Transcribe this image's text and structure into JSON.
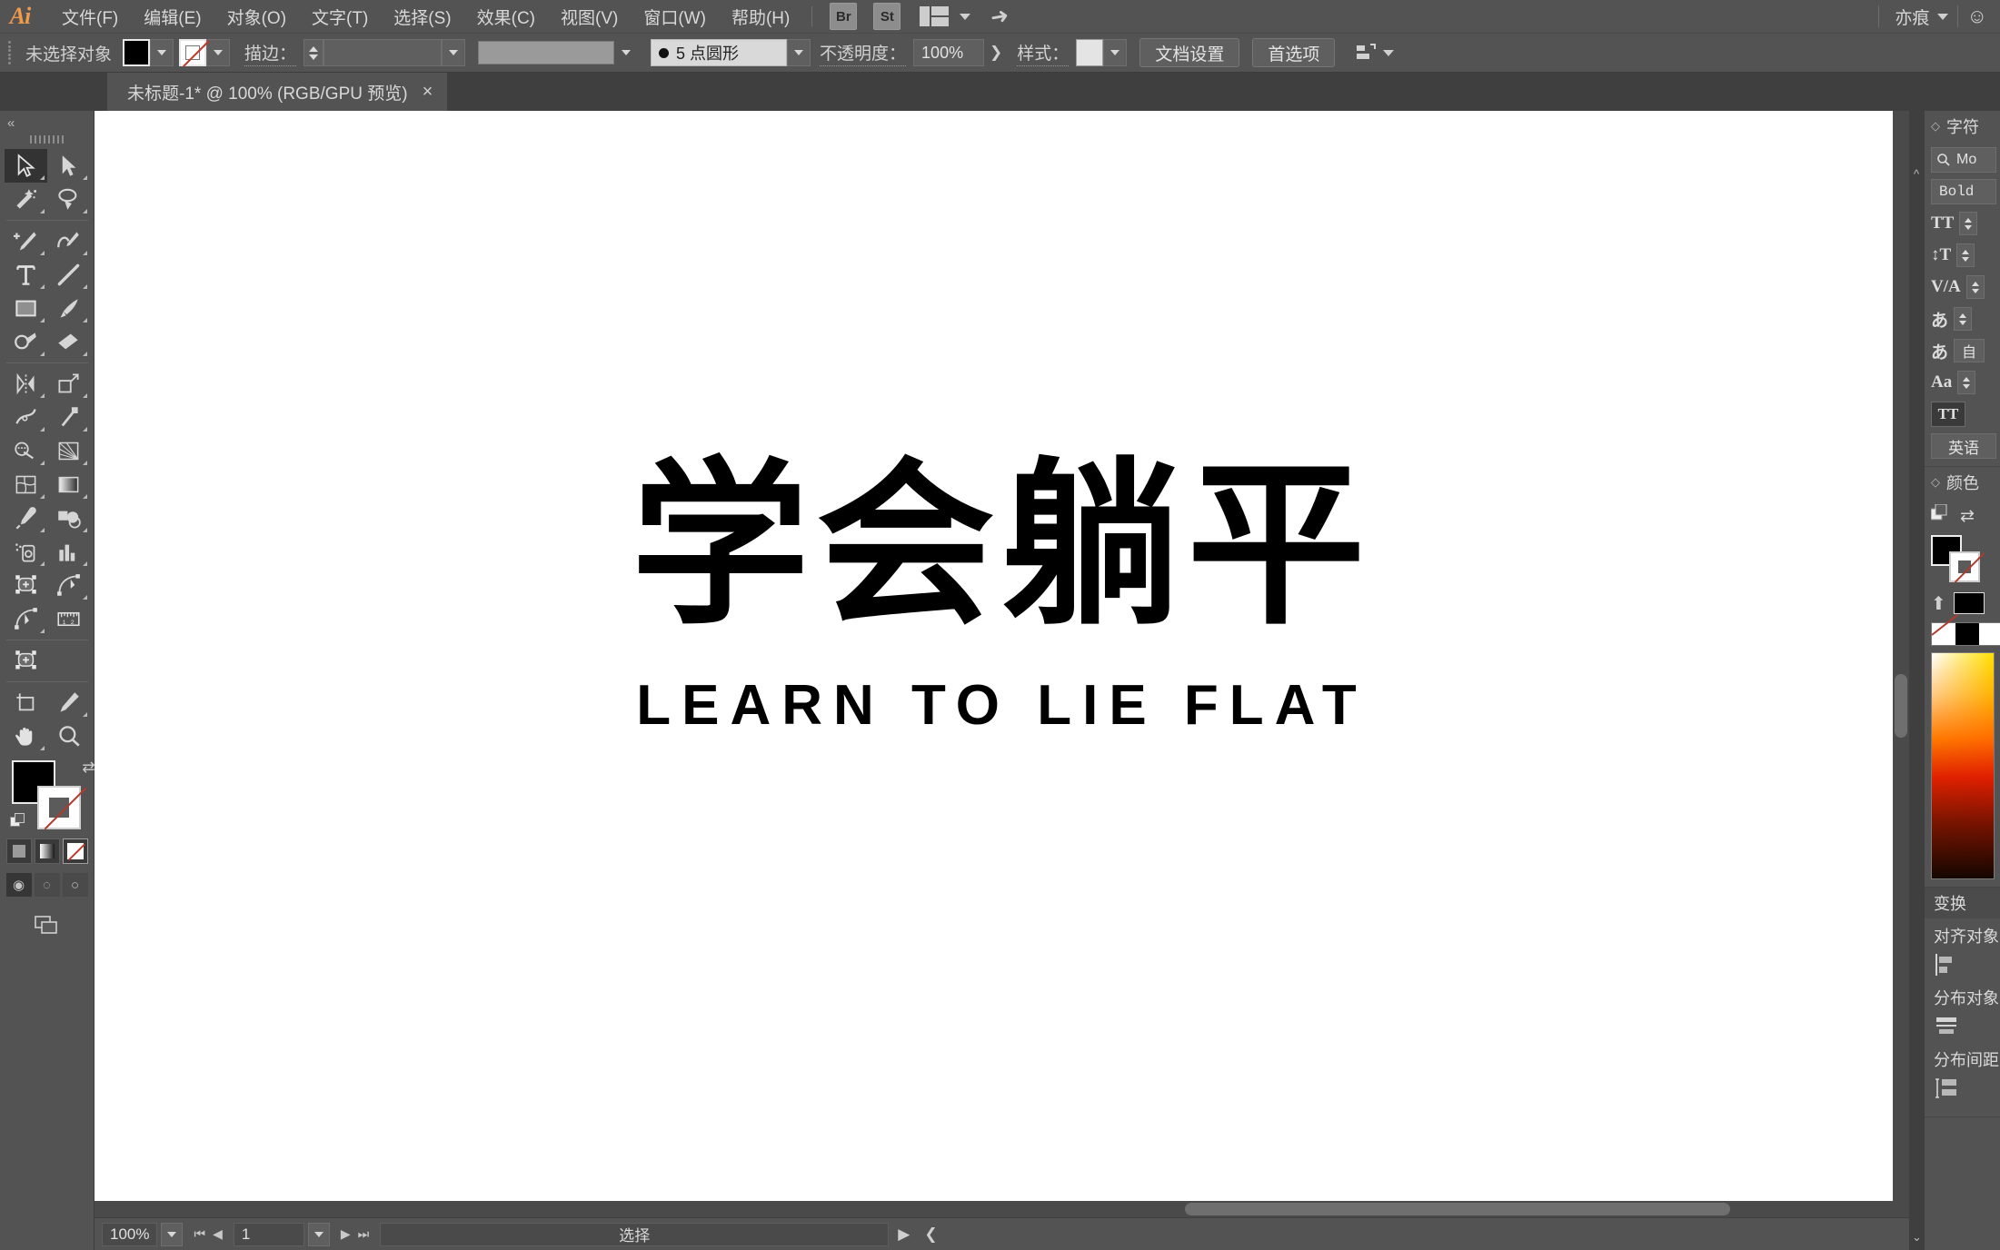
{
  "app": {
    "name": "Adobe Illustrator",
    "logo_text": "Ai",
    "user_name": "亦痕"
  },
  "menubar": {
    "items": [
      {
        "label": "文件(F)",
        "name": "menu-file"
      },
      {
        "label": "编辑(E)",
        "name": "menu-edit"
      },
      {
        "label": "对象(O)",
        "name": "menu-object"
      },
      {
        "label": "文字(T)",
        "name": "menu-type"
      },
      {
        "label": "选择(S)",
        "name": "menu-select"
      },
      {
        "label": "效果(C)",
        "name": "menu-effect"
      },
      {
        "label": "视图(V)",
        "name": "menu-view"
      },
      {
        "label": "窗口(W)",
        "name": "menu-window"
      },
      {
        "label": "帮助(H)",
        "name": "menu-help"
      }
    ],
    "bridge_button": "Br",
    "stock_button": "St",
    "workspace_icon": "workspace-layout-icon",
    "rocket_icon": "discover-rocket-icon"
  },
  "controlbar": {
    "selection_status": "未选择对象",
    "fill_color": "#000000",
    "stroke_color": "none",
    "stroke_label": "描边：",
    "stroke_weight": "",
    "stroke_profile": "",
    "brush_definition": "5 点圆形",
    "opacity_label": "不透明度：",
    "opacity_value": "100%",
    "style_label": "样式：",
    "document_setup_button": "文档设置",
    "preferences_button": "首选项",
    "align_icon": "align-to-selection-icon"
  },
  "tabbar": {
    "tabs": [
      {
        "title": "未标题-1* @ 100% (RGB/GPU 预览)",
        "close": "×",
        "active": true
      }
    ]
  },
  "toolpanel": {
    "collapse_icon": "«",
    "tools": [
      {
        "name": "selection-tool",
        "label": "选择工具",
        "selected": true
      },
      {
        "name": "direct-selection-tool",
        "label": "直接选择工具",
        "selected": false
      },
      {
        "name": "magic-wand-tool",
        "label": "魔棒工具",
        "selected": false
      },
      {
        "name": "lasso-tool",
        "label": "套索工具",
        "selected": false
      },
      {
        "name": "pen-tool",
        "label": "钢笔工具",
        "selected": false
      },
      {
        "name": "curvature-tool",
        "label": "曲率工具",
        "selected": false
      },
      {
        "name": "type-tool",
        "label": "文字工具",
        "selected": false
      },
      {
        "name": "line-segment-tool",
        "label": "直线段工具",
        "selected": false
      },
      {
        "name": "rectangle-tool",
        "label": "矩形工具",
        "selected": false
      },
      {
        "name": "paintbrush-tool",
        "label": "画笔工具",
        "selected": false
      },
      {
        "name": "shaper-tool",
        "label": "Shaper 工具",
        "selected": false
      },
      {
        "name": "eraser-tool",
        "label": "橡皮擦工具",
        "selected": false
      },
      {
        "name": "rotate-tool",
        "label": "旋转工具",
        "selected": false
      },
      {
        "name": "scale-tool",
        "label": "比例缩放工具",
        "selected": false
      },
      {
        "name": "width-tool",
        "label": "宽度工具",
        "selected": false
      },
      {
        "name": "free-transform-tool",
        "label": "自由变换工具",
        "selected": false
      },
      {
        "name": "shape-builder-tool",
        "label": "形状生成器工具",
        "selected": false
      },
      {
        "name": "perspective-grid-tool",
        "label": "透视网格工具",
        "selected": false
      },
      {
        "name": "mesh-tool",
        "label": "网格工具",
        "selected": false
      },
      {
        "name": "gradient-tool",
        "label": "渐变工具",
        "selected": false
      },
      {
        "name": "eyedropper-tool",
        "label": "吸管工具",
        "selected": false
      },
      {
        "name": "blend-tool",
        "label": "混合工具",
        "selected": false
      },
      {
        "name": "symbol-sprayer-tool",
        "label": "符号喷枪工具",
        "selected": false
      },
      {
        "name": "column-graph-tool",
        "label": "柱形图工具",
        "selected": false
      },
      {
        "name": "artboard-tool",
        "label": "画板工具",
        "selected": false
      },
      {
        "name": "slice-tool",
        "label": "切片工具",
        "selected": false
      },
      {
        "name": "hand-tool",
        "label": "抓手工具",
        "selected": false
      },
      {
        "name": "zoom-tool",
        "label": "缩放工具",
        "selected": false
      }
    ],
    "fill_color": "#000000",
    "stroke_color": "none",
    "swap_icon": "swap-fill-stroke-icon",
    "default_icon": "default-fill-stroke-icon",
    "paint_modes": [
      {
        "name": "color-mode",
        "label": "颜色",
        "selected": false
      },
      {
        "name": "gradient-mode",
        "label": "渐变",
        "selected": false
      },
      {
        "name": "none-mode",
        "label": "无",
        "selected": true
      }
    ],
    "screen_modes": [
      {
        "name": "drawing-mode-normal",
        "selected": true
      },
      {
        "name": "drawing-mode-behind",
        "selected": false
      },
      {
        "name": "drawing-mode-inside",
        "selected": false
      }
    ],
    "screen_mode_icon": "change-screen-mode-icon"
  },
  "canvas": {
    "artwork_cn": "学会躺平",
    "artwork_en": "LEARN TO LIE FLAT",
    "background": "#ffffff",
    "artwork_color": "#000000"
  },
  "statusbar": {
    "zoom": "100%",
    "page_number": "1",
    "tool_status": "选择",
    "first_icon": "first-artboard-icon",
    "prev_icon": "previous-artboard-icon",
    "next_icon": "next-artboard-icon",
    "last_icon": "last-artboard-icon"
  },
  "rightdock": {
    "panels": [
      {
        "title": "字符",
        "name": "character-panel",
        "font_family": "Mo",
        "font_style": "Bold",
        "search_icon": "font-search-icon",
        "rows": [
          {
            "icon": "font-size-icon",
            "glyph": "TT",
            "value": ""
          },
          {
            "icon": "leading-icon",
            "glyph": "↕T",
            "value": ""
          },
          {
            "icon": "kerning-icon",
            "glyph": "V/A",
            "value": ""
          },
          {
            "icon": "tsume-icon",
            "glyph": "あ",
            "value": ""
          },
          {
            "icon": "aki-icon",
            "glyph": "あ",
            "value": "自"
          },
          {
            "icon": "baseline-shift-icon",
            "glyph": "Aa",
            "value": ""
          }
        ],
        "case_button": "TT",
        "language": "英语"
      },
      {
        "title": "颜色",
        "name": "color-panel",
        "fill_color": "#000000",
        "stroke_color": "none",
        "swap_icon": "swap-fill-stroke-icon",
        "none_swatch": "none",
        "black_swatch": "#000000",
        "white_swatch": "#ffffff",
        "spectrum": "color-spectrum-ramp"
      },
      {
        "title": "变换",
        "name": "transform-panel"
      },
      {
        "title": "对齐对象",
        "name": "align-objects-group",
        "icon": "align-left-icon"
      },
      {
        "title": "分布对象",
        "name": "distribute-objects-group",
        "icon": "distribute-vertical-center-icon"
      },
      {
        "title": "分布间距",
        "name": "distribute-spacing-group",
        "icon": "distribute-spacing-icon"
      }
    ]
  }
}
